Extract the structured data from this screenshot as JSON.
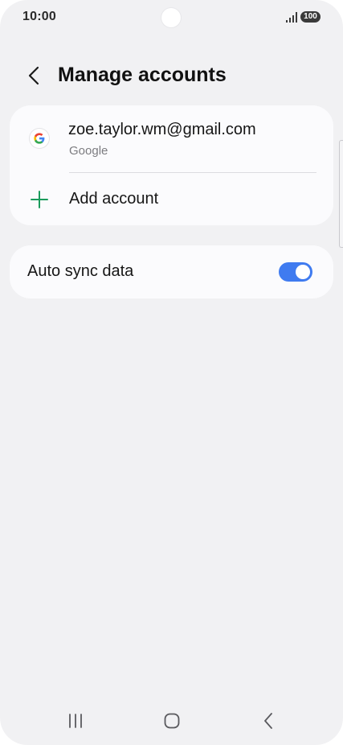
{
  "status_bar": {
    "time": "10:00",
    "battery": "100"
  },
  "header": {
    "title": "Manage accounts"
  },
  "accounts": {
    "items": [
      {
        "email": "zoe.taylor.wm@gmail.com",
        "provider": "Google",
        "icon": "google-icon"
      }
    ],
    "add_label": "Add account"
  },
  "sync": {
    "label": "Auto sync data",
    "enabled": true
  },
  "colors": {
    "toggle_on": "#3f7bf0",
    "add_icon": "#1a9b5c",
    "background": "#f1f1f3",
    "card": "#fbfbfd"
  },
  "icons": {
    "back": "chevron-left-icon",
    "add": "plus-icon",
    "nav_recent": "recent-apps-icon",
    "nav_home": "home-icon",
    "nav_back": "back-icon"
  }
}
